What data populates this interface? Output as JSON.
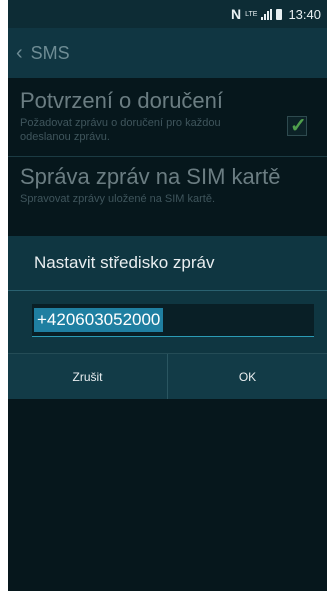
{
  "status": {
    "nfc": "N",
    "network": "LTE",
    "time": "13:40"
  },
  "appbar": {
    "title": "SMS"
  },
  "settings": [
    {
      "title": "Potvrzení o doručení",
      "subtitle": "Požadovat zprávu o doručení pro každou odeslanou zprávu.",
      "checked": true
    },
    {
      "title": "Správa zpráv na SIM kartě",
      "subtitle": "Spravovat zprávy uložené na SIM kartě."
    }
  ],
  "dialog": {
    "title": "Nastavit středisko zpráv",
    "input_value": "+420603052000",
    "cancel_label": "Zrušit",
    "ok_label": "OK"
  },
  "icons": {
    "back": "chevron-left-icon",
    "check": "checkmark-icon",
    "signal": "signal-icon",
    "battery": "battery-icon"
  }
}
